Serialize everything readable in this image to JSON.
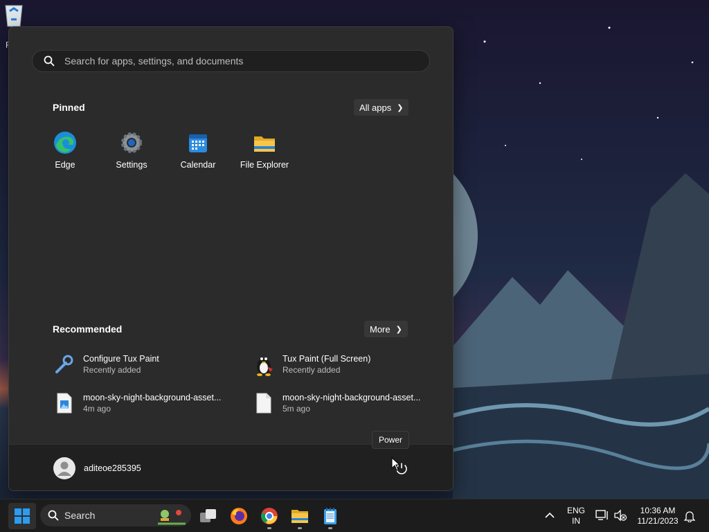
{
  "desktop": {
    "recycle_label_fragment": "R"
  },
  "start_menu": {
    "search": {
      "placeholder": "Search for apps, settings, and documents"
    },
    "pinned": {
      "title": "Pinned",
      "all_apps_label": "All apps",
      "apps": [
        {
          "label": "Edge",
          "icon": "edge-icon"
        },
        {
          "label": "Settings",
          "icon": "settings-gear-icon"
        },
        {
          "label": "Calendar",
          "icon": "calendar-icon"
        },
        {
          "label": "File Explorer",
          "icon": "folder-icon"
        }
      ]
    },
    "recommended": {
      "title": "Recommended",
      "more_label": "More",
      "items": [
        {
          "name": "Configure Tux Paint",
          "sub": "Recently added",
          "icon": "wrench-icon"
        },
        {
          "name": "Tux Paint (Full Screen)",
          "sub": "Recently added",
          "icon": "tux-penguin-icon"
        },
        {
          "name": "moon-sky-night-background-asset...",
          "sub": "4m ago",
          "icon": "image-file-icon"
        },
        {
          "name": "moon-sky-night-background-asset...",
          "sub": "5m ago",
          "icon": "blank-file-icon"
        }
      ]
    },
    "footer": {
      "user_name": "aditeoe285395",
      "power_tooltip": "Power"
    }
  },
  "taskbar": {
    "search_label": "Search",
    "language": {
      "line1": "ENG",
      "line2": "IN"
    },
    "clock": {
      "time": "10:36 AM",
      "date": "11/21/2023"
    }
  },
  "colors": {
    "menu_bg": "#2b2b2b",
    "footer_bg": "#202020",
    "taskbar_bg": "#1c1c1c",
    "accent": "#0078d4"
  }
}
